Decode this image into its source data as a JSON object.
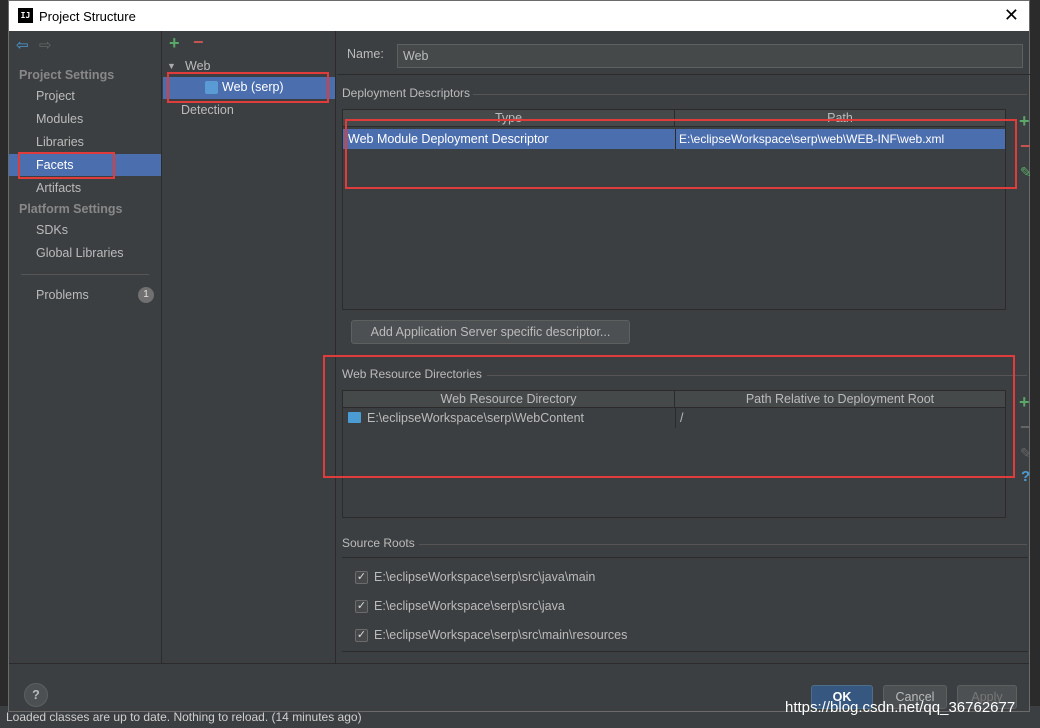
{
  "window": {
    "title": "Project Structure"
  },
  "nav": {
    "project_settings": "Project Settings",
    "items_project": [
      "Project",
      "Modules",
      "Libraries",
      "Facets",
      "Artifacts"
    ],
    "platform_settings": "Platform Settings",
    "items_platform": [
      "SDKs",
      "Global Libraries"
    ],
    "problems": "Problems",
    "problems_count": "1",
    "selected": "Facets"
  },
  "tree": {
    "root": "Web",
    "child": "Web (serp)",
    "detection": "Detection"
  },
  "main": {
    "name_label": "Name:",
    "name_value": "Web",
    "deployment_section": "Deployment Descriptors",
    "dd_columns": [
      "Type",
      "Path"
    ],
    "dd_rows": [
      {
        "type": "Web Module Deployment Descriptor",
        "path": "E:\\eclipseWorkspace\\serp\\web\\WEB-INF\\web.xml"
      }
    ],
    "add_descriptor_button": "Add Application Server specific descriptor...",
    "web_resource_section": "Web Resource Directories",
    "wr_columns": [
      "Web Resource Directory",
      "Path Relative to Deployment Root"
    ],
    "wr_rows": [
      {
        "dir": "E:\\eclipseWorkspace\\serp\\WebContent",
        "rel": "/"
      }
    ],
    "source_roots_section": "Source Roots",
    "source_roots": [
      "E:\\eclipseWorkspace\\serp\\src\\java\\main",
      "E:\\eclipseWorkspace\\serp\\src\\java",
      "E:\\eclipseWorkspace\\serp\\src\\main\\resources"
    ]
  },
  "footer": {
    "ok": "OK",
    "cancel": "Cancel",
    "apply": "Apply",
    "help": "?"
  },
  "background": {
    "status_text": "Loaded classes are up to date. Nothing to reload. (14 minutes ago)"
  },
  "watermark": "https://blog.csdn.net/qq_36762677",
  "colors": {
    "selection": "#4b6eaf",
    "annotation": "#e03c3c",
    "add": "#59a869",
    "remove": "#c75450"
  }
}
